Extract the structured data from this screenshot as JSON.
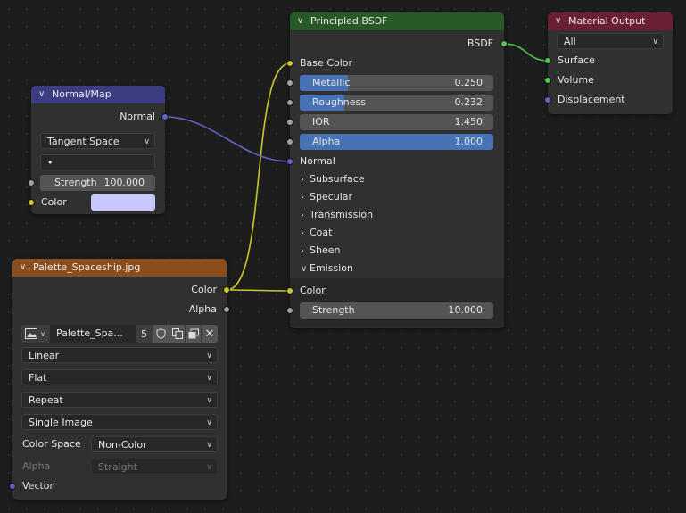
{
  "colors": {
    "canvas": "#1d1d1d",
    "node_body": "#303030",
    "header_vector": "#3c3c83",
    "header_shader": "#275a27",
    "header_texture": "#8a4e1e",
    "header_output": "#6b1f33",
    "socket_color": "#c7c729",
    "socket_float": "#a1a1a1",
    "socket_vector": "#6363c7",
    "socket_shader": "#4ec64e",
    "slider_fill": "#4772b3",
    "wire_yellow": "#c7c729",
    "wire_purple": "#6363c7",
    "wire_green": "#4ec64e"
  },
  "normal_map": {
    "title": "Normal/Map",
    "output_normal": "Normal",
    "space": "Tangent Space",
    "uv_map": "•",
    "strength_label": "Strength",
    "strength_value": "100.000",
    "color_label": "Color",
    "color_swatch": "#c8c8ff"
  },
  "bsdf": {
    "title": "Principled BSDF",
    "output": "BSDF",
    "base_color": "Base Color",
    "sliders": [
      {
        "name": "Metallic",
        "value": "0.250",
        "fill": 0.25
      },
      {
        "name": "Roughness",
        "value": "0.232",
        "fill": 0.232
      },
      {
        "name": "IOR",
        "value": "1.450",
        "fill": 0
      },
      {
        "name": "Alpha",
        "value": "1.000",
        "fill": 1.0
      }
    ],
    "normal": "Normal",
    "panels": [
      "Subsurface",
      "Specular",
      "Transmission",
      "Coat",
      "Sheen"
    ],
    "emission": {
      "label": "Emission",
      "color": "Color",
      "strength_label": "Strength",
      "strength_value": "10.000"
    }
  },
  "material_output": {
    "title": "Material Output",
    "target": "All",
    "inputs": [
      "Surface",
      "Volume",
      "Displacement"
    ]
  },
  "image_texture": {
    "title": "Palette_Spaceship.jpg",
    "outputs": [
      "Color",
      "Alpha"
    ],
    "image_name": "Palette_Spa...",
    "users": "5",
    "interpolation": "Linear",
    "projection": "Flat",
    "extension": "Repeat",
    "source": "Single Image",
    "color_space_label": "Color Space",
    "color_space": "Non-Color",
    "alpha_label": "Alpha",
    "alpha_mode": "Straight",
    "vector_input": "Vector"
  }
}
